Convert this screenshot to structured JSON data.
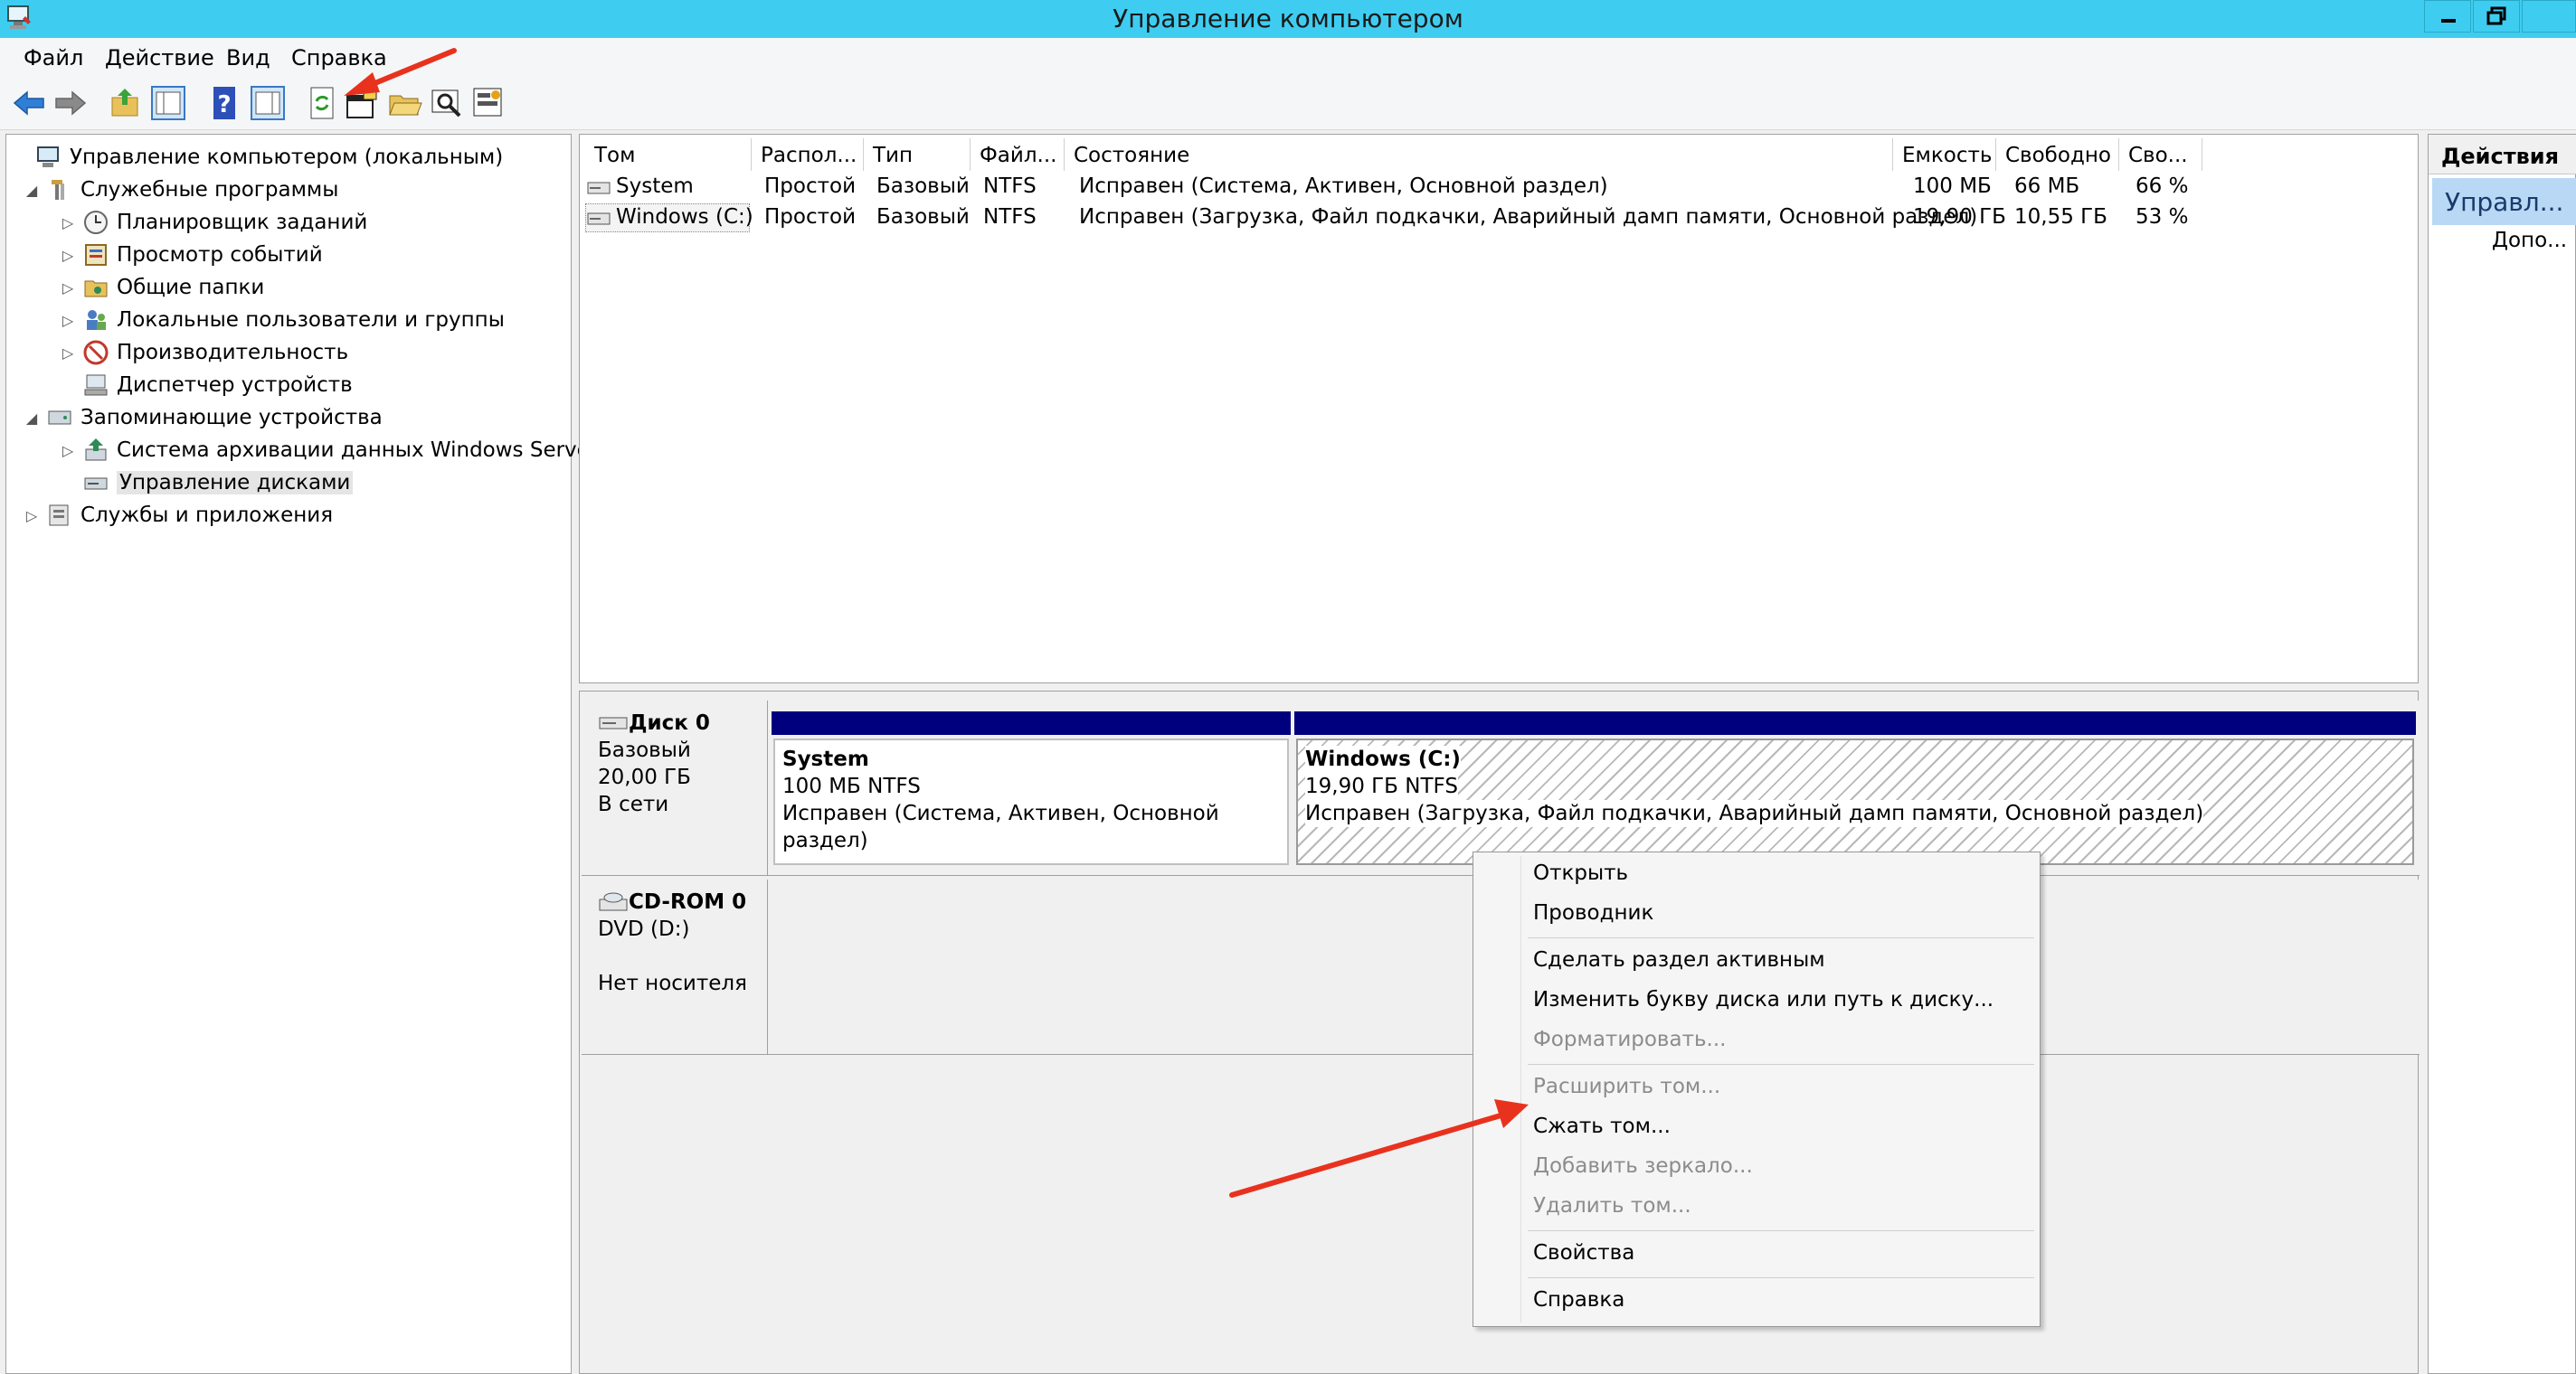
{
  "window": {
    "title": "Управление компьютером"
  },
  "menu": [
    "Файл",
    "Действие",
    "Вид",
    "Справка"
  ],
  "tree": [
    {
      "label": "Управление компьютером (локальным)",
      "icon": "computer-icon",
      "expander": ""
    },
    {
      "label": "Служебные программы",
      "icon": "tools-icon",
      "expander": "◢"
    },
    {
      "label": "Планировщик заданий",
      "icon": "clock-icon",
      "expander": "▷"
    },
    {
      "label": "Просмотр событий",
      "icon": "event-viewer-icon",
      "expander": "▷"
    },
    {
      "label": "Общие папки",
      "icon": "shared-folder-icon",
      "expander": "▷"
    },
    {
      "label": "Локальные пользователи и группы",
      "icon": "users-icon",
      "expander": "▷"
    },
    {
      "label": "Производительность",
      "icon": "performance-icon",
      "expander": "▷"
    },
    {
      "label": "Диспетчер устройств",
      "icon": "device-manager-icon",
      "expander": ""
    },
    {
      "label": "Запоминающие устройства",
      "icon": "storage-icon",
      "expander": "◢"
    },
    {
      "label": "Система архивации данных Windows Server",
      "icon": "backup-icon",
      "expander": "▷"
    },
    {
      "label": "Управление дисками",
      "icon": "disk-management-icon",
      "expander": ""
    },
    {
      "label": "Службы и приложения",
      "icon": "services-icon",
      "expander": "▷"
    }
  ],
  "volume_table": {
    "columns": [
      "Том",
      "Распол...",
      "Тип",
      "Файл...",
      "Состояние",
      "Емкость",
      "Свободно",
      "Сво..."
    ],
    "rows": [
      [
        "System",
        "Простой",
        "Базовый",
        "NTFS",
        "Исправен (Система, Активен, Основной раздел)",
        "100 МБ",
        "66 МБ",
        "66 %"
      ],
      [
        "Windows (C:)",
        "Простой",
        "Базовый",
        "NTFS",
        "Исправен (Загрузка, Файл подкачки, Аварийный дамп памяти, Основной раздел)",
        "19,90 ГБ",
        "10,55 ГБ",
        "53 %"
      ]
    ]
  },
  "disks": [
    {
      "name": "Диск 0",
      "type": "Базовый",
      "size": "20,00 ГБ",
      "status": "В сети",
      "partitions": [
        {
          "name": "System",
          "size": "100 МБ NTFS",
          "status": "Исправен (Система, Активен, Основной раздел)"
        },
        {
          "name": "Windows  (C:)",
          "size": "19,90 ГБ NTFS",
          "status": "Исправен (Загрузка, Файл подкачки, Аварийный дамп памяти, Основной раздел)"
        }
      ]
    },
    {
      "name": "CD-ROM 0",
      "type": "DVD (D:)",
      "status": "Нет носителя"
    }
  ],
  "actions": {
    "header": "Действия",
    "selected": "Управл...",
    "more": "Допо..."
  },
  "context_menu": [
    {
      "label": "Открыть",
      "enabled": true
    },
    {
      "label": "Проводник",
      "enabled": true
    },
    {
      "label": "Сделать раздел активным",
      "enabled": true
    },
    {
      "label": "Изменить букву диска или путь к диску...",
      "enabled": true
    },
    {
      "label": "Форматировать...",
      "enabled": false
    },
    {
      "label": "Расширить том...",
      "enabled": false
    },
    {
      "label": "Сжать том...",
      "enabled": true
    },
    {
      "label": "Добавить зеркало...",
      "enabled": false
    },
    {
      "label": "Удалить том...",
      "enabled": false
    },
    {
      "label": "Свойства",
      "enabled": true
    },
    {
      "label": "Справка",
      "enabled": true
    }
  ],
  "colors": {
    "titlebar": "#3ecdf0",
    "partition_header": "#00007f",
    "annotation_arrow": "#e8321e",
    "action_selected": "#b8d8f5"
  }
}
